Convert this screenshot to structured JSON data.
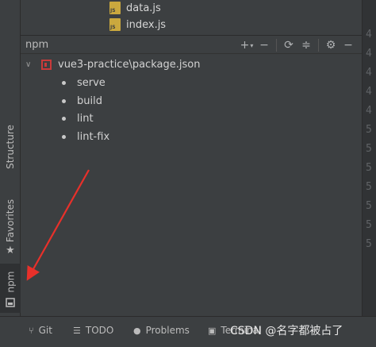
{
  "project_tree": {
    "files": [
      {
        "name": "data.js"
      },
      {
        "name": "index.js"
      }
    ]
  },
  "npm_panel": {
    "title": "npm",
    "toolbar": [
      "add-icon",
      "collapse-icon",
      "reload-icon",
      "expand-collapse-icon",
      "gear-icon",
      "minimize-icon"
    ],
    "package_path": "vue3-practice\\package.json",
    "scripts": [
      "serve",
      "build",
      "lint",
      "lint-fix"
    ]
  },
  "left_tabs": {
    "structure": "Structure",
    "favorites": "Favorites",
    "npm": "npm"
  },
  "gutter": {
    "line_numbers": [
      "4",
      "4",
      "4",
      "4",
      "4",
      "5",
      "5",
      "5",
      "5",
      "5",
      "5",
      "5"
    ]
  },
  "bottom_tabs": {
    "git": "Git",
    "todo": "TODO",
    "problems": "Problems",
    "terminal": "Terminal"
  },
  "watermark": "CSDN @名字都被占了",
  "colors": {
    "annotation_arrow": "#e8302a",
    "package_icon": "#c93a3a"
  }
}
